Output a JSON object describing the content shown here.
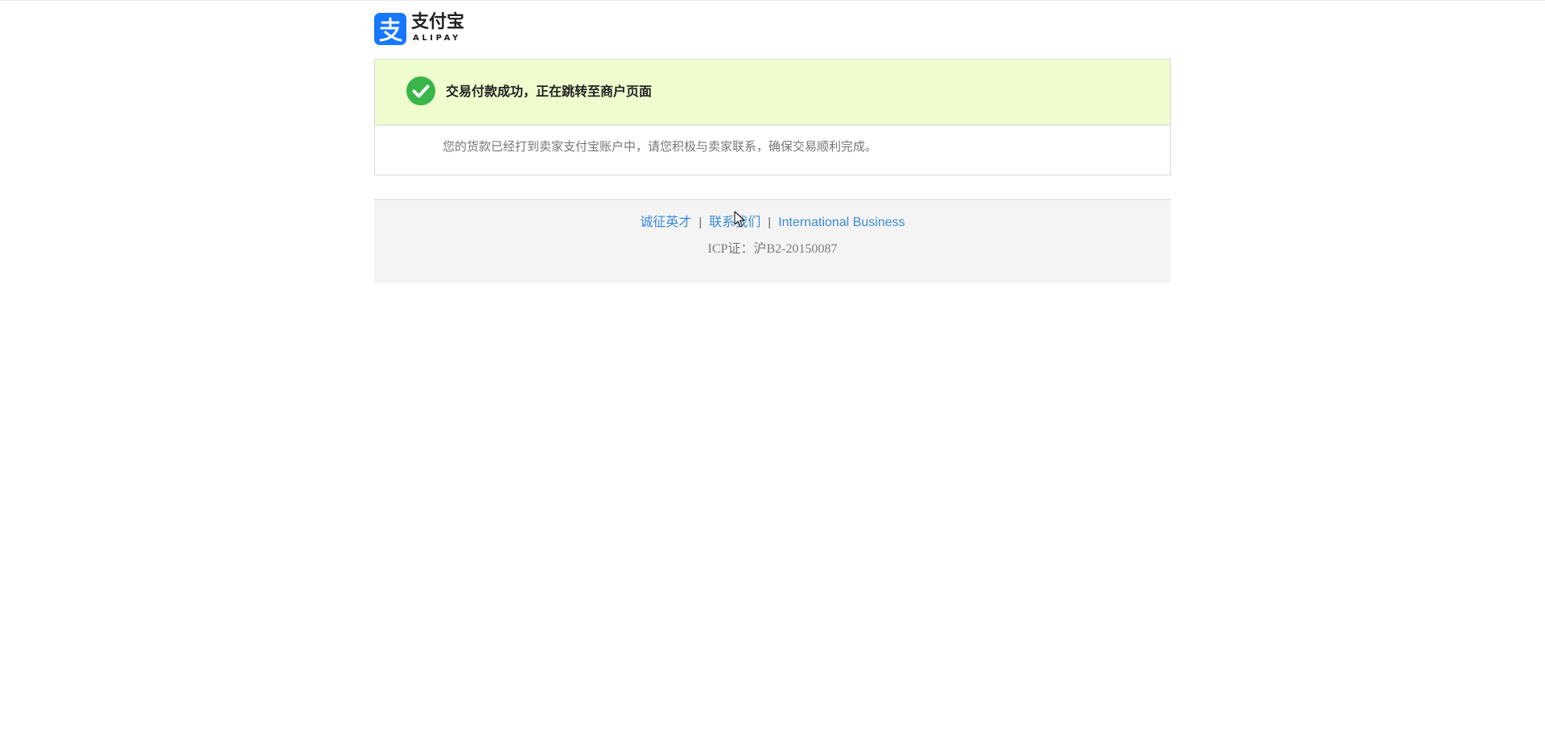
{
  "brand": {
    "name_cn": "支付宝",
    "name_en": "ALIPAY",
    "logo_glyph": "支",
    "color": "#1677ff"
  },
  "status": {
    "title": "交易付款成功，正在跳转至商户页面",
    "message": "您的货款已经打到卖家支付宝账户中，请您积极与卖家联系，确保交易顺利完成。",
    "icon": "check-circle-icon",
    "color": "#3ab54a",
    "banner_color": "#eefcce"
  },
  "footer": {
    "links": [
      {
        "label": "诚征英才"
      },
      {
        "label": "联系我们"
      },
      {
        "label": "International Business"
      }
    ],
    "separator": "|",
    "icp": "ICP证：沪B2-20150087",
    "link_color": "#3b8bd6"
  }
}
